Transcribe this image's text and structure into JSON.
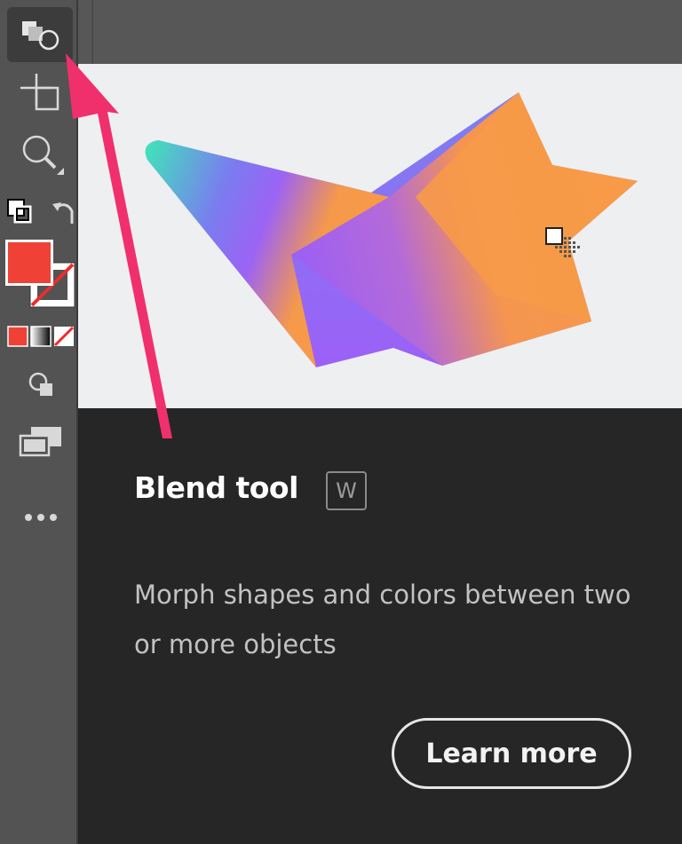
{
  "tooltip": {
    "title": "Blend tool",
    "shortcut": "W",
    "description": "Morph shapes and colors between two or more objects",
    "learn_more_label": "Learn more"
  },
  "toolbar": {
    "tools": [
      {
        "name": "blend-tool",
        "icon": "blend-icon",
        "active": true
      },
      {
        "name": "artboard-tool",
        "icon": "artboard-icon"
      },
      {
        "name": "zoom-tool",
        "icon": "zoom-icon"
      },
      {
        "name": "default-fill-stroke",
        "icon": "default-colors-icon"
      },
      {
        "name": "swap-fill-stroke",
        "icon": "swap-icon"
      },
      {
        "name": "fill-stroke-swatch",
        "icon": "fill-stroke-icon"
      },
      {
        "name": "color-modes",
        "icon": "color-gradient-none-icon"
      },
      {
        "name": "draw-modes",
        "icon": "draw-mode-icon"
      },
      {
        "name": "screen-modes",
        "icon": "screen-mode-icon"
      },
      {
        "name": "edit-toolbar",
        "icon": "more-icon"
      }
    ],
    "fill_color": "#ef4136"
  },
  "colors": {
    "annotation_arrow": "#f0306d",
    "panel_bg": "#262626",
    "preview_bg": "#eeeff1"
  }
}
